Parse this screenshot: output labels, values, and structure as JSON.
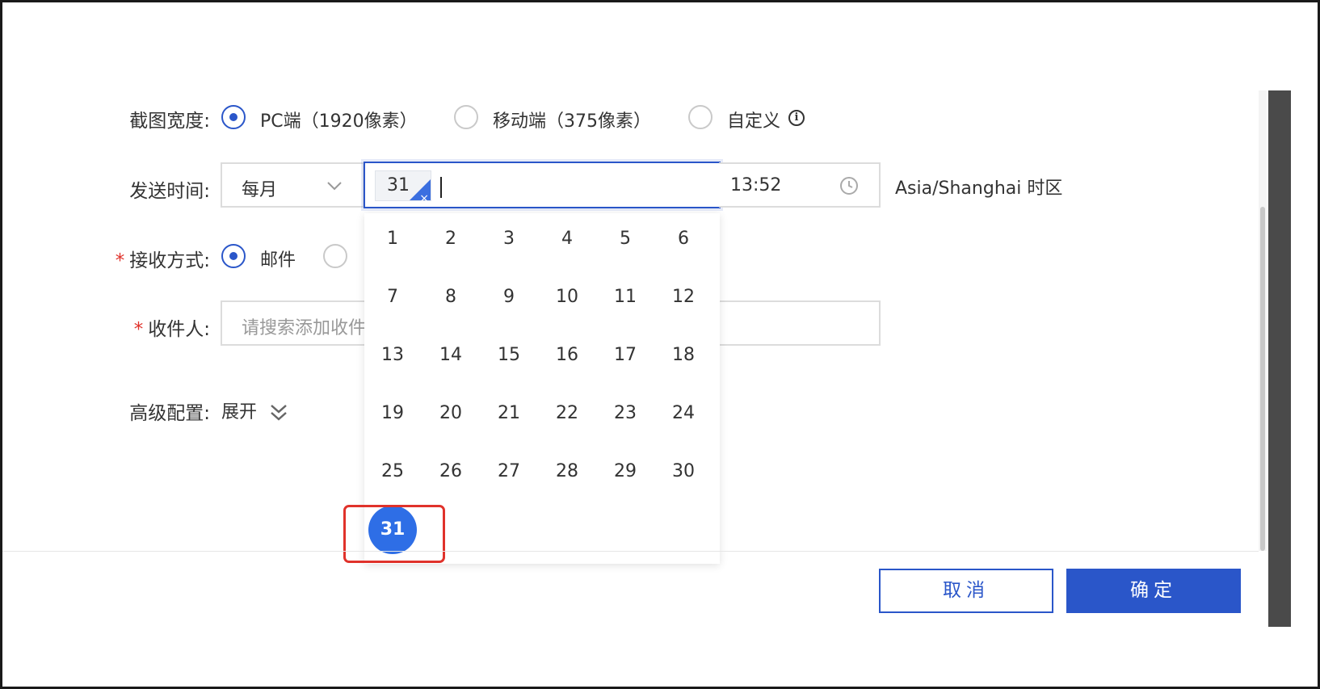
{
  "form": {
    "screenshot_width": {
      "label": "截图宽度:",
      "options": [
        "PC端（1920像素）",
        "移动端（375像素）",
        "自定义"
      ],
      "selected_index": 0
    },
    "send_time": {
      "label": "发送时间:",
      "frequency": "每月",
      "selected_day_tag": "31",
      "time_value": "13:52",
      "timezone": "Asia/Shanghai 时区"
    },
    "receive_method": {
      "label": "接收方式:",
      "option_email": "邮件",
      "required_mark": "*"
    },
    "recipients": {
      "label": "收件人:",
      "placeholder": "请搜索添加收件人",
      "required_mark": "*"
    },
    "advanced": {
      "label": "高级配置:",
      "toggle": "展开"
    }
  },
  "day_picker": {
    "days": [
      "1",
      "2",
      "3",
      "4",
      "5",
      "6",
      "7",
      "8",
      "9",
      "10",
      "11",
      "12",
      "13",
      "14",
      "15",
      "16",
      "17",
      "18",
      "19",
      "20",
      "21",
      "22",
      "23",
      "24",
      "25",
      "26",
      "27",
      "28",
      "29",
      "30",
      "31"
    ],
    "selected": "31"
  },
  "footer": {
    "cancel": "取消",
    "confirm": "确定"
  },
  "colors": {
    "accent": "#2a56c9",
    "selected_day": "#2e6ee6",
    "required": "#e0322b"
  }
}
